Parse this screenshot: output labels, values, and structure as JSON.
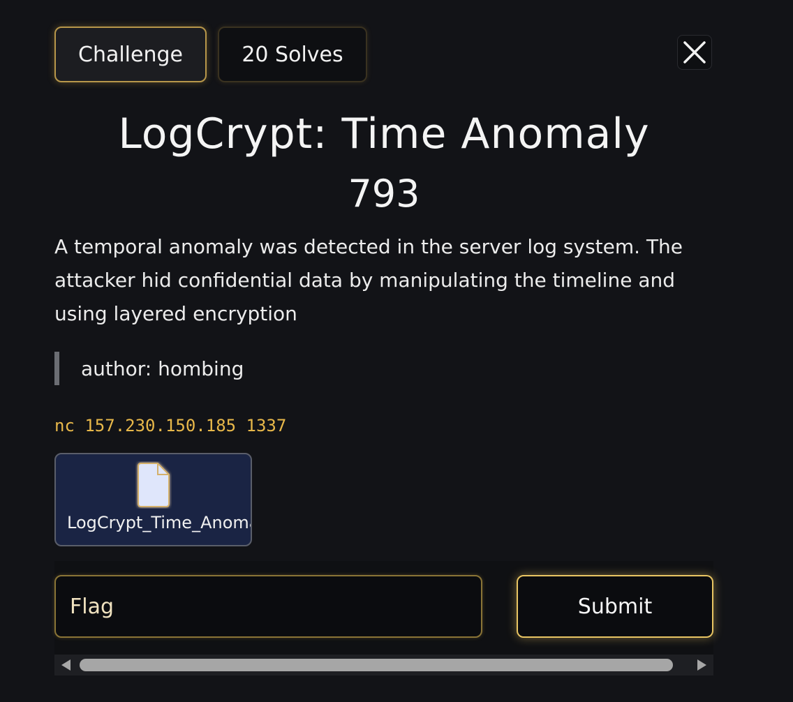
{
  "tabs": {
    "challenge_label": "Challenge",
    "solves_label": "20 Solves"
  },
  "challenge": {
    "title": "LogCrypt: Time Anomaly",
    "points": "793",
    "description": "A temporal anomaly was detected in the server log system. The attacker hid confidential data by manipulating the timeline and using layered encryption",
    "author": "author: hombing",
    "connection": "nc 157.230.150.185 1337"
  },
  "file": {
    "name": "LogCrypt_Time_Anomaly",
    "icon": "file-icon"
  },
  "flag_form": {
    "placeholder": "Flag",
    "value": "",
    "submit_label": "Submit"
  },
  "colors": {
    "background": "#121317",
    "accent_gold": "#e9c563",
    "connection_text": "#e8b84a",
    "file_card_bg": "#1a2444"
  }
}
